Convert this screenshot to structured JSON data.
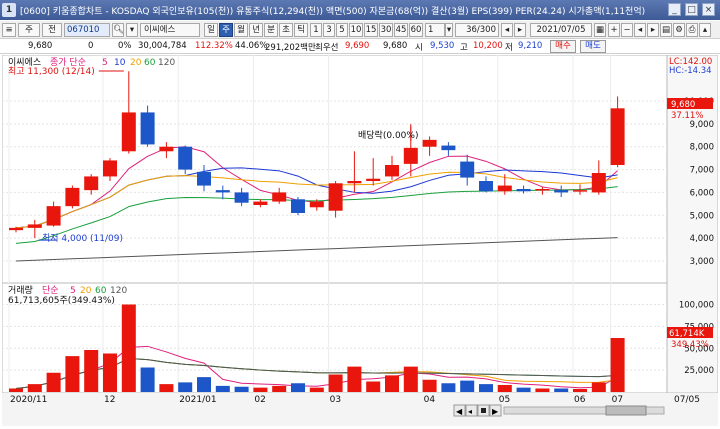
{
  "window": {
    "number": "1",
    "info_text": "[0600] 키움종합차트 - KOSDAQ 외국인보유(105(천)) 유통주식(12,294(천)) 액면(500) 자본금(68(억)) 결산(3월) EPS(399) PER(24.24) 시가총액(1,11천억)"
  },
  "toolbar": {
    "interval_buttons": [
      "주",
      "전"
    ],
    "stock_code": "067010",
    "stock_name": "이씨에스",
    "period_buttons": [
      "일",
      "주",
      "월",
      "년",
      "분",
      "초",
      "틱"
    ],
    "selected_period": "주",
    "minute_buttons": [
      "1",
      "3",
      "5",
      "10",
      "15",
      "30",
      "45",
      "60"
    ],
    "count_value": "1",
    "range_value": "36/300",
    "date_value": "2021/07/05"
  },
  "quote": {
    "price": "9,680",
    "change": "0",
    "change_pct": "0%",
    "volume": "30,004,784",
    "vol_ratio": "112.32%",
    "turnover": "44.06%",
    "amount": "291,202백만",
    "prev_close_label": "최우선",
    "best_ask": "9,690",
    "best_bid": "9,680",
    "open_label": "시",
    "open": "9,530",
    "high_label": "고",
    "high": "10,200",
    "low_label": "저",
    "low": "9,210",
    "buy_button": "매수",
    "sell_button": "매도"
  },
  "price_panel": {
    "legend_name": "이씨에스",
    "legend_ma": "종가 단순",
    "ma_periods": [
      "5",
      "10",
      "20",
      "60",
      "120"
    ],
    "max_annotation": "최고 11,300 (12/14)",
    "min_annotation": "최저 4,000 (11/09)",
    "event_label": "배당락(0.00%)",
    "lc_label": "LC:142.00",
    "hc_label": "HC:-14.34",
    "current_price_tag": "9,680",
    "current_pct_tag": "37.11%"
  },
  "volume_panel": {
    "legend_name": "거래량",
    "legend_ma": "단순",
    "ma_periods": [
      "5",
      "20",
      "60",
      "120"
    ],
    "current_text": "61,713,605주(349.43%)",
    "current_tag": "61,714K",
    "current_pct_tag": "349.43%"
  },
  "x_axis_labels": [
    "2020/11",
    "12",
    "2021/01",
    "02",
    "03",
    "04",
    "05",
    "06",
    "07"
  ],
  "x_axis_right": "07/05",
  "chart_data": {
    "type": "candlestick",
    "price_axis": {
      "ticks": [
        3000,
        4000,
        5000,
        6000,
        7000,
        8000,
        9000,
        10000
      ],
      "tick_labels": [
        "3,000",
        "4,000",
        "5,000",
        "6,000",
        "7,000",
        "8,000",
        "9,000",
        "10,000"
      ],
      "range": [
        2300,
        11400
      ]
    },
    "volume_axis": {
      "ticks": [
        25000,
        50000,
        75000,
        100000
      ],
      "tick_labels": [
        "25,000",
        "50,000",
        "75,000",
        "100,000"
      ],
      "unit": "K",
      "range": [
        0,
        120000
      ]
    },
    "colors": {
      "up": "#e8160c",
      "down": "#1d56c8",
      "ma5": "#e0207d",
      "ma10": "#1c38d4",
      "ma20": "#f0a000",
      "ma60": "#18a03c",
      "ma120": "#555555"
    },
    "candles": [
      {
        "o": 4350,
        "h": 4500,
        "l": 4250,
        "c": 4450,
        "v": 4000
      },
      {
        "o": 4450,
        "h": 4800,
        "l": 4000,
        "c": 4600,
        "v": 9000
      },
      {
        "o": 4550,
        "h": 5600,
        "l": 4500,
        "c": 5400,
        "v": 22000
      },
      {
        "o": 5400,
        "h": 6300,
        "l": 5300,
        "c": 6200,
        "v": 41000
      },
      {
        "o": 6100,
        "h": 6800,
        "l": 5900,
        "c": 6700,
        "v": 48000
      },
      {
        "o": 6700,
        "h": 7500,
        "l": 6500,
        "c": 7400,
        "v": 44000
      },
      {
        "o": 7800,
        "h": 11300,
        "l": 7700,
        "c": 9500,
        "v": 100000
      },
      {
        "o": 9500,
        "h": 9800,
        "l": 8000,
        "c": 8100,
        "v": 28000
      },
      {
        "o": 7800,
        "h": 8200,
        "l": 7500,
        "c": 8000,
        "v": 9000
      },
      {
        "o": 8000,
        "h": 8050,
        "l": 6800,
        "c": 7000,
        "v": 11000
      },
      {
        "o": 6900,
        "h": 7200,
        "l": 6050,
        "c": 6300,
        "v": 17000
      },
      {
        "o": 6100,
        "h": 6300,
        "l": 5700,
        "c": 6000,
        "v": 7000
      },
      {
        "o": 6000,
        "h": 6200,
        "l": 5400,
        "c": 5550,
        "v": 6000
      },
      {
        "o": 5450,
        "h": 5700,
        "l": 5350,
        "c": 5600,
        "v": 5000
      },
      {
        "o": 5600,
        "h": 6200,
        "l": 5500,
        "c": 6000,
        "v": 7000
      },
      {
        "o": 5700,
        "h": 5800,
        "l": 5000,
        "c": 5100,
        "v": 10000
      },
      {
        "o": 5350,
        "h": 5700,
        "l": 5200,
        "c": 5600,
        "v": 5000
      },
      {
        "o": 5200,
        "h": 6500,
        "l": 4900,
        "c": 6400,
        "v": 20000
      },
      {
        "o": 6400,
        "h": 7800,
        "l": 6000,
        "c": 6500,
        "v": 29000
      },
      {
        "o": 6500,
        "h": 7500,
        "l": 6300,
        "c": 6600,
        "v": 12000
      },
      {
        "o": 6700,
        "h": 7600,
        "l": 6550,
        "c": 7200,
        "v": 19000
      },
      {
        "o": 7250,
        "h": 8900,
        "l": 6700,
        "c": 7950,
        "v": 29000
      },
      {
        "o": 8000,
        "h": 8450,
        "l": 7600,
        "c": 8300,
        "v": 14000
      },
      {
        "o": 8050,
        "h": 8200,
        "l": 7600,
        "c": 7850,
        "v": 10000
      },
      {
        "o": 7350,
        "h": 7650,
        "l": 6300,
        "c": 6650,
        "v": 13000
      },
      {
        "o": 6500,
        "h": 6700,
        "l": 6000,
        "c": 6050,
        "v": 9000
      },
      {
        "o": 6050,
        "h": 6800,
        "l": 5900,
        "c": 6300,
        "v": 8000
      },
      {
        "o": 6150,
        "h": 6300,
        "l": 5950,
        "c": 6050,
        "v": 5000
      },
      {
        "o": 6100,
        "h": 6250,
        "l": 5900,
        "c": 6150,
        "v": 4000
      },
      {
        "o": 6100,
        "h": 6300,
        "l": 5800,
        "c": 6000,
        "v": 4000
      },
      {
        "o": 6050,
        "h": 6350,
        "l": 5900,
        "c": 6100,
        "v": 3500
      },
      {
        "o": 6000,
        "h": 7400,
        "l": 5900,
        "c": 6850,
        "v": 11000
      },
      {
        "o": 7200,
        "h": 10200,
        "l": 7100,
        "c": 9680,
        "v": 61714
      }
    ]
  }
}
